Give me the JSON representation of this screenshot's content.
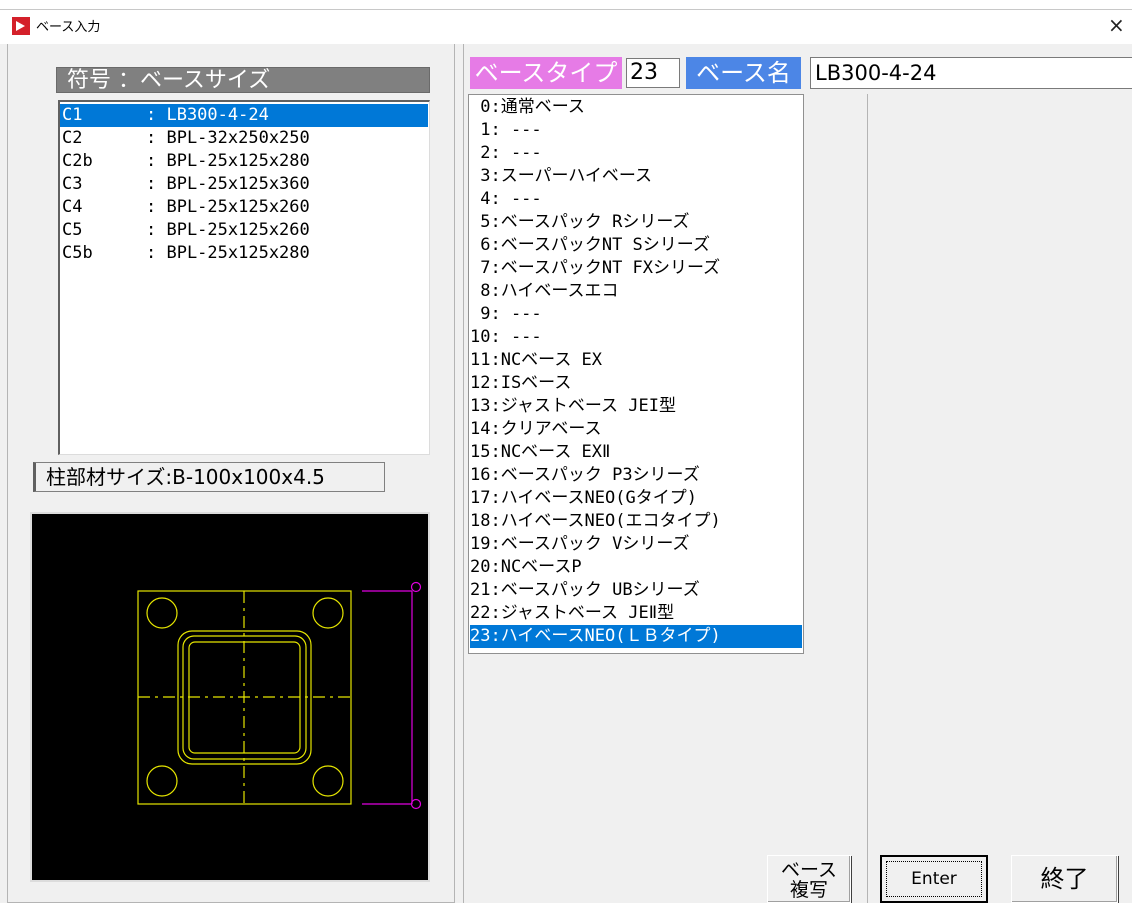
{
  "window": {
    "title": "ベース入力",
    "close_glyph": "×"
  },
  "left": {
    "list_header": "符号 ：ベースサイズ",
    "rows": [
      {
        "code": "C1",
        "size": ": LB300-4-24"
      },
      {
        "code": "C2",
        "size": ": BPL-32x250x250"
      },
      {
        "code": "C2b",
        "size": ": BPL-25x125x280"
      },
      {
        "code": "C3",
        "size": ": BPL-25x125x360"
      },
      {
        "code": "C4",
        "size": ": BPL-25x125x260"
      },
      {
        "code": "C5",
        "size": ": BPL-25x125x260"
      },
      {
        "code": "C5b",
        "size": ": BPL-25x125x280"
      }
    ],
    "selected_index": 0,
    "member_size": "柱部材サイズ:B-100x100x4.5"
  },
  "right": {
    "base_type_label": "ベースタイプ",
    "base_type_value": "23",
    "base_name_label": "ベース名",
    "base_name_value": "LB300-4-24",
    "types": [
      " 0:通常ベース",
      " 1: ---",
      " 2: ---",
      " 3:スーパーハイベース",
      " 4: ---",
      " 5:ベースパック Rシリーズ",
      " 6:ベースパックNT Sシリーズ",
      " 7:ベースパックNT FXシリーズ",
      " 8:ハイベースエコ",
      " 9: ---",
      "10: ---",
      "11:NCベース EX",
      "12:ISベース",
      "13:ジャストベース JEI型",
      "14:クリアベース",
      "15:NCベース EXⅡ",
      "16:ベースパック P3シリーズ",
      "17:ハイベースNEO(Gタイプ)",
      "18:ハイベースNEO(エコタイプ)",
      "19:ベースパック Vシリーズ",
      "20:NCベースP",
      "21:ベースパック UBシリーズ",
      "22:ジャストベース JEⅡ型",
      "23:ハイベースNEO(ＬＢタイプ)"
    ],
    "selected_type_index": 23
  },
  "buttons": {
    "copy_line1": "ベース",
    "copy_line2": "複写",
    "enter": "Enter",
    "end": "終了"
  },
  "colors": {
    "selection": "#0078d7",
    "type_label_bg": "#e67be6",
    "name_label_bg": "#4c86e6",
    "drawing_yellow": "#e6e600",
    "drawing_magenta": "#e000e0"
  }
}
